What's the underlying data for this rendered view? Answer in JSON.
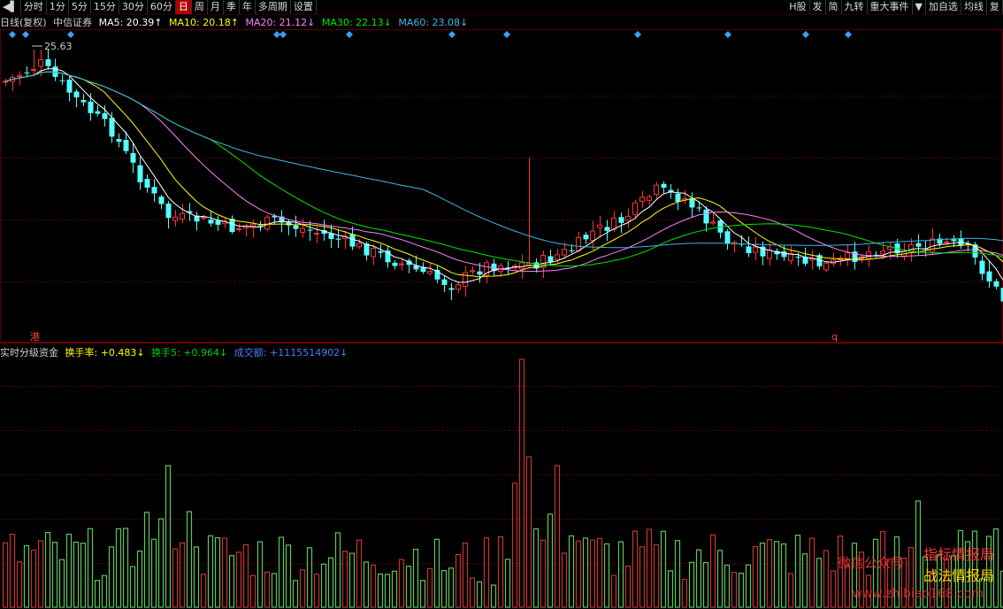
{
  "toolbar": {
    "back_label": "◀▌",
    "items": [
      "分时",
      "1分",
      "5分",
      "15分",
      "30分",
      "60分",
      "日",
      "周",
      "月",
      "季",
      "年",
      "多周期",
      "设置"
    ],
    "active": "日",
    "right_items": [
      "H股",
      "发",
      "简",
      "九转",
      "重大事件",
      "▼",
      "加自选",
      "均线",
      "复"
    ]
  },
  "info": {
    "period": "日线(复权)",
    "stock": "中信证券",
    "ma5": "MA5: 20.39↑",
    "ma10": "MA10: 20.18↑",
    "ma20": "MA20: 21.12↓",
    "ma30": "MA30: 22.13↓",
    "ma60": "MA60: 23.08↓"
  },
  "price_chart": {
    "high_label": "25.63",
    "marker_left": "港",
    "marker_right": "q"
  },
  "sub_info": {
    "title": "实时分级资金",
    "turnover": "换手率: +0.483↓",
    "turnover5": "换手5: +0.964↓",
    "amount": "成交额: +1115514902↓"
  },
  "watermark": {
    "wechat": "微信公众号",
    "name1": "指标情报局",
    "name2": "战法情报局",
    "site": "www.zhibiao168.com"
  },
  "colors": {
    "up": "#ff3232",
    "down": "#54ffff",
    "ma5": "#ffffff",
    "ma10": "#ffff00",
    "ma20": "#ff80ff",
    "ma30": "#00e600",
    "ma60": "#3fb6e6",
    "vol_up": "#c83232",
    "vol_down": "#5ac85a",
    "diamond": "#3aa0ff"
  },
  "chart_data": {
    "type": "candlestick",
    "price_max": 25.63
  }
}
